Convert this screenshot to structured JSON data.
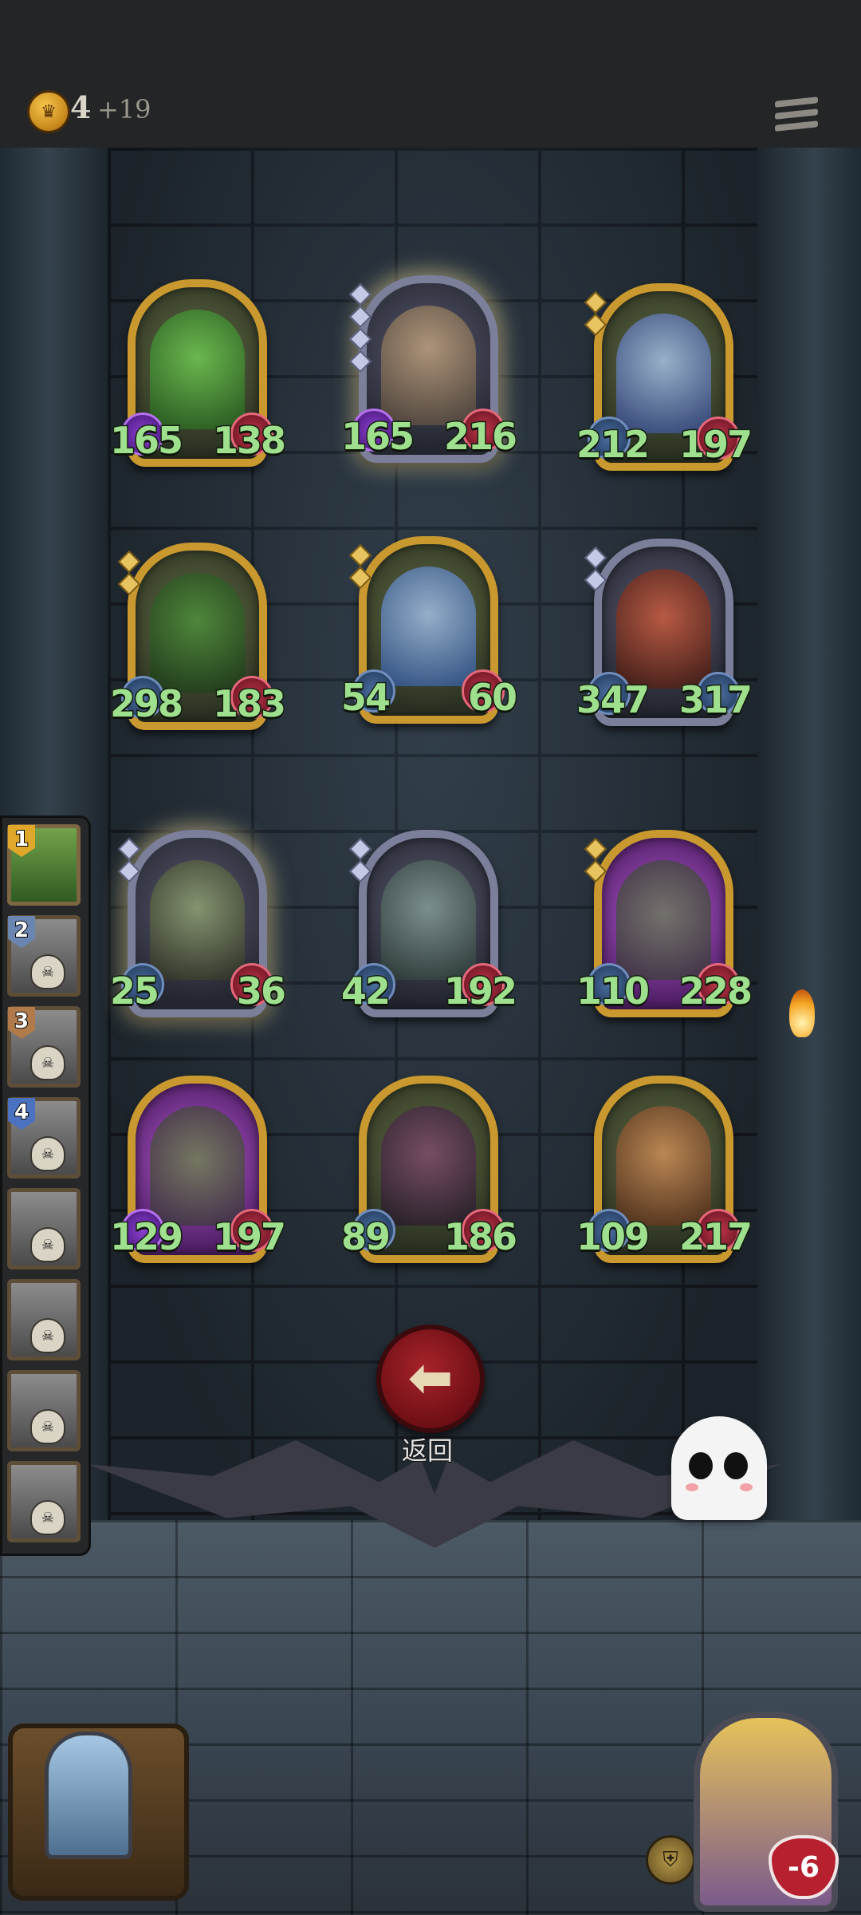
{
  "header": {
    "gold": "4",
    "gold_income": "+19",
    "menu_icon": "hamburger-menu-icon"
  },
  "cards": [
    {
      "atk": "165",
      "hp": "138"
    },
    {
      "atk": "165",
      "hp": "216"
    },
    {
      "atk": "212",
      "hp": "197"
    },
    {
      "atk": "298",
      "hp": "183"
    },
    {
      "atk": "54",
      "hp": "60"
    },
    {
      "atk": "347",
      "hp": "317"
    },
    {
      "atk": "25",
      "hp": "36"
    },
    {
      "atk": "42",
      "hp": "192"
    },
    {
      "atk": "110",
      "hp": "228"
    },
    {
      "atk": "129",
      "hp": "197"
    },
    {
      "atk": "89",
      "hp": "186"
    },
    {
      "atk": "109",
      "hp": "217"
    }
  ],
  "team_slots": [
    "1",
    "2",
    "3",
    "4",
    "",
    "",
    "",
    ""
  ],
  "back_button": {
    "label": "返回",
    "icon": "arrow-left-icon"
  },
  "player": {
    "health_delta": "-6"
  },
  "colors": {
    "gold_frame": "#c9992f",
    "silver_frame": "#7c7f99",
    "stat_text": "#9fe08e",
    "back_button": "#a8232a"
  }
}
